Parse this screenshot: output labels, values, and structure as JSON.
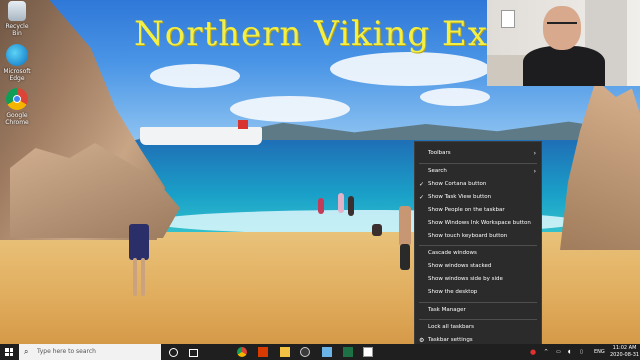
{
  "wallpaper": {
    "title": "Northern Viking Explorer"
  },
  "desktop_icons": [
    {
      "label": "Recycle Bin",
      "icon": "recycle-bin-icon"
    },
    {
      "label": "Microsoft Edge",
      "icon": "edge-icon"
    },
    {
      "label": "Google Chrome",
      "icon": "chrome-icon"
    }
  ],
  "context_menu": {
    "items": [
      {
        "label": "Toolbars",
        "submenu": true,
        "checked": false
      },
      {
        "label": "Search",
        "submenu": true,
        "checked": false
      },
      {
        "label": "Show Cortana button",
        "submenu": false,
        "checked": true
      },
      {
        "label": "Show Task View button",
        "submenu": false,
        "checked": true
      },
      {
        "label": "Show People on the taskbar",
        "submenu": false,
        "checked": false
      },
      {
        "label": "Show Windows Ink Workspace button",
        "submenu": false,
        "checked": false
      },
      {
        "label": "Show touch keyboard button",
        "submenu": false,
        "checked": false
      },
      {
        "label": "Cascade windows",
        "submenu": false,
        "checked": false
      },
      {
        "label": "Show windows stacked",
        "submenu": false,
        "checked": false
      },
      {
        "label": "Show windows side by side",
        "submenu": false,
        "checked": false
      },
      {
        "label": "Show the desktop",
        "submenu": false,
        "checked": false
      },
      {
        "label": "Task Manager",
        "submenu": false,
        "checked": false
      },
      {
        "label": "Lock all taskbars",
        "submenu": false,
        "checked": false
      },
      {
        "label": "Taskbar settings",
        "submenu": false,
        "checked": false,
        "icon": "gear-icon"
      }
    ]
  },
  "taskbar": {
    "search_placeholder": "Type here to search",
    "apps": [
      "cortana-icon",
      "task-view-icon",
      "chrome-icon",
      "office-icon",
      "file-explorer-icon",
      "obs-icon",
      "files-icon",
      "excel-icon",
      "mail-icon"
    ],
    "tray": {
      "language": "ENG"
    },
    "clock": {
      "time": "11:02 AM",
      "date": "2020-08-31"
    }
  },
  "colors": {
    "menu_bg": "#2b2b2b",
    "taskbar_bg": "#1f1f1f",
    "title_yellow": "#f3ef44"
  }
}
